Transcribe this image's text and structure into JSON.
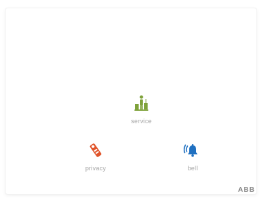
{
  "controls": {
    "service": {
      "label": "service",
      "icon": "service-cleaning-icon",
      "color": "#7fa23a"
    },
    "privacy": {
      "label": "privacy",
      "icon": "do-not-disturb-hanger-icon",
      "color": "#e0542a"
    },
    "bell": {
      "label": "bell",
      "icon": "ringing-bell-icon",
      "color": "#1f70c1"
    }
  },
  "brand": {
    "logo_text": "ABB"
  }
}
